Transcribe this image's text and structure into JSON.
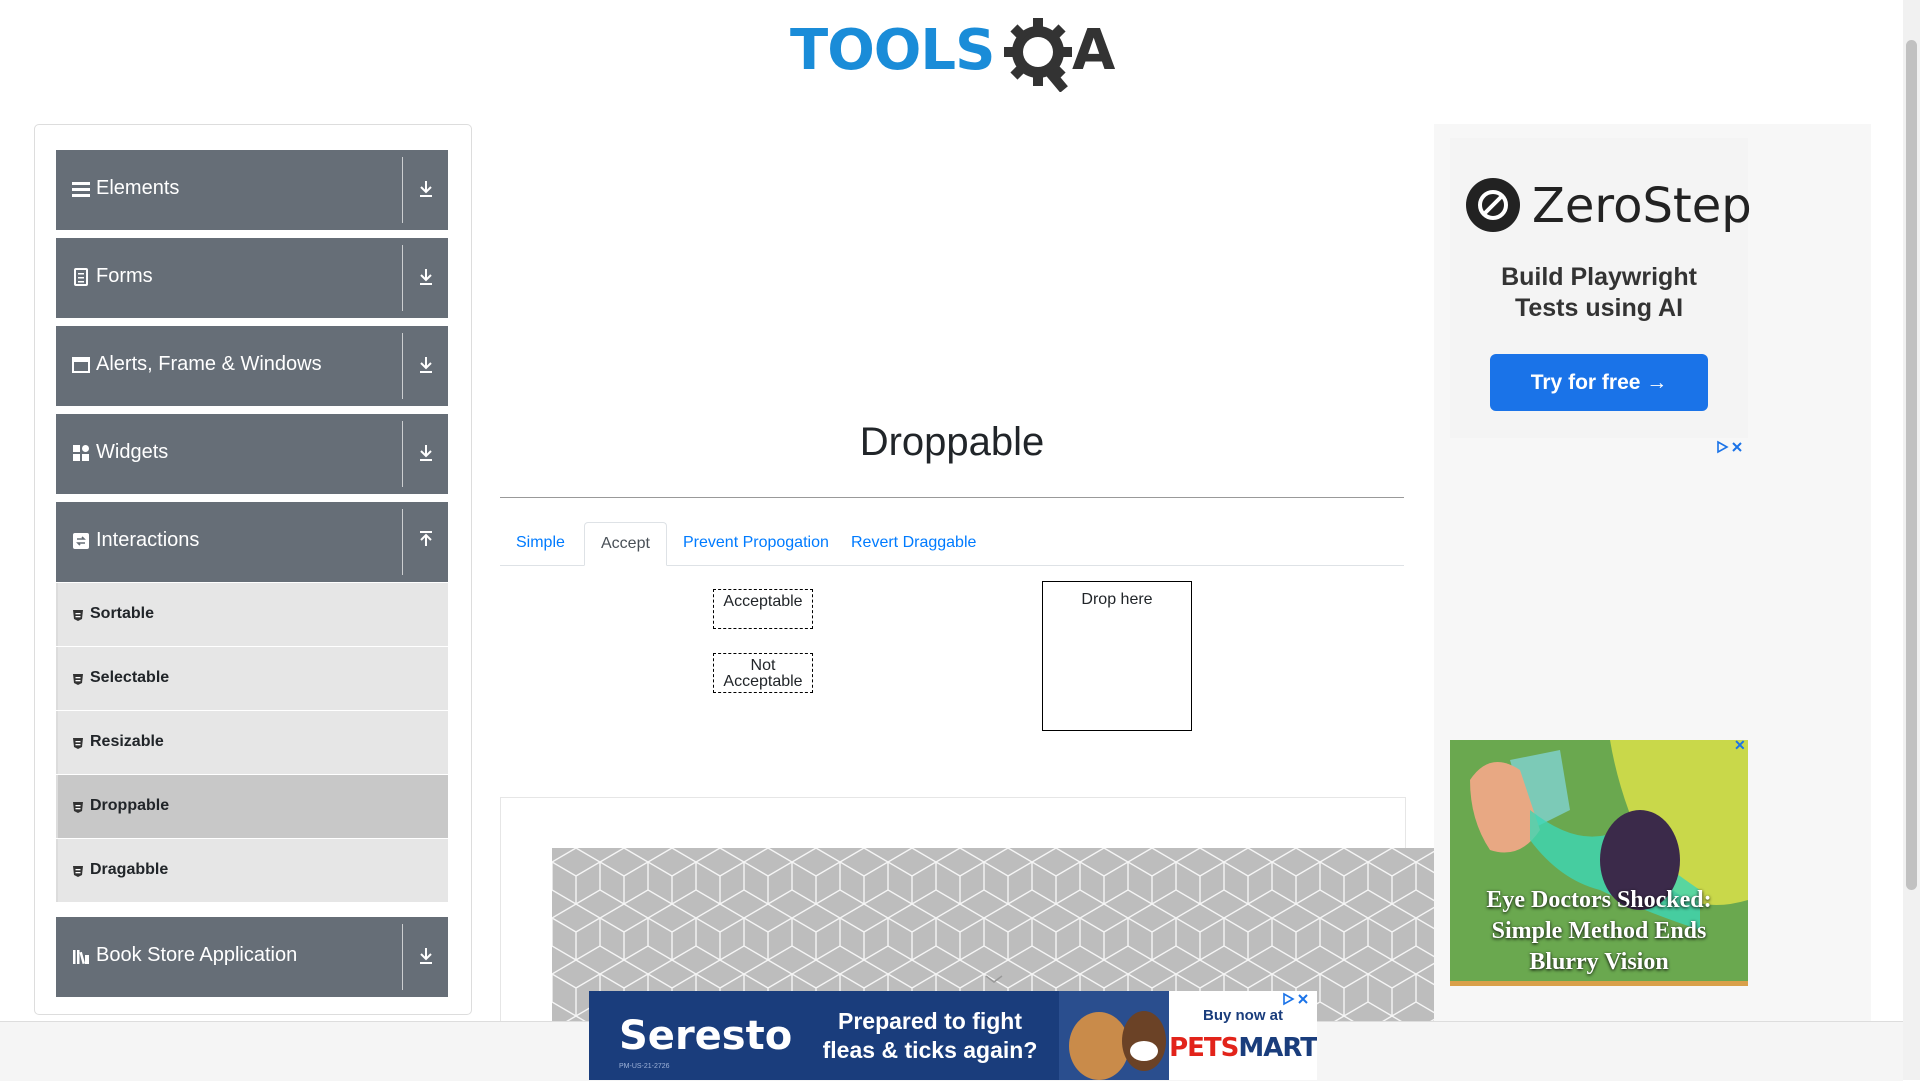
{
  "header": {
    "logo_text": "TOOLS",
    "logo_letter": "A"
  },
  "sidebar": {
    "groups": [
      {
        "label": "Elements",
        "icon": "hamburger-icon"
      },
      {
        "label": "Forms",
        "icon": "document-icon"
      },
      {
        "label": "Alerts, Frame & Windows",
        "icon": "window-icon"
      },
      {
        "label": "Widgets",
        "icon": "grid-icon"
      },
      {
        "label": "Interactions",
        "icon": "interaction-icon",
        "expanded": true
      },
      {
        "label": "Book Store Application",
        "icon": "books-icon"
      }
    ],
    "items": [
      {
        "label": "Sortable"
      },
      {
        "label": "Selectable"
      },
      {
        "label": "Resizable"
      },
      {
        "label": "Droppable",
        "active": true
      },
      {
        "label": "Dragabble"
      }
    ]
  },
  "main": {
    "title": "Droppable",
    "tabs": [
      "Simple",
      "Accept",
      "Prevent Propogation",
      "Revert Draggable"
    ],
    "active_tab": "Accept",
    "acceptable": "Acceptable",
    "not_acceptable_line1": "Not",
    "not_acceptable_line2": "Acceptable",
    "drop_here": "Drop here"
  },
  "ads": {
    "zerostep": {
      "brand": "ZeroStep",
      "tagline_line1": "Build Playwright",
      "tagline_line2": "Tests using AI",
      "button": "Try for free →"
    },
    "eye": {
      "line1": "Eye Doctors Shocked:",
      "line2": "Simple Method Ends",
      "line3": "Blurry Vision"
    },
    "seresto": {
      "brand": "Seresto",
      "tag_line1": "Prepared to fight",
      "tag_line2": "fleas & ticks again?",
      "fine_print": "PM-US-21-2726",
      "buy_now": "Buy now at",
      "store_a": "PETS",
      "store_b": "MART"
    }
  },
  "colors": {
    "nav_group_bg": "#666e77",
    "nav_item_bg": "#e6e6e6",
    "tab_link": "#007bff",
    "logo_blue": "#1a8cd8"
  }
}
